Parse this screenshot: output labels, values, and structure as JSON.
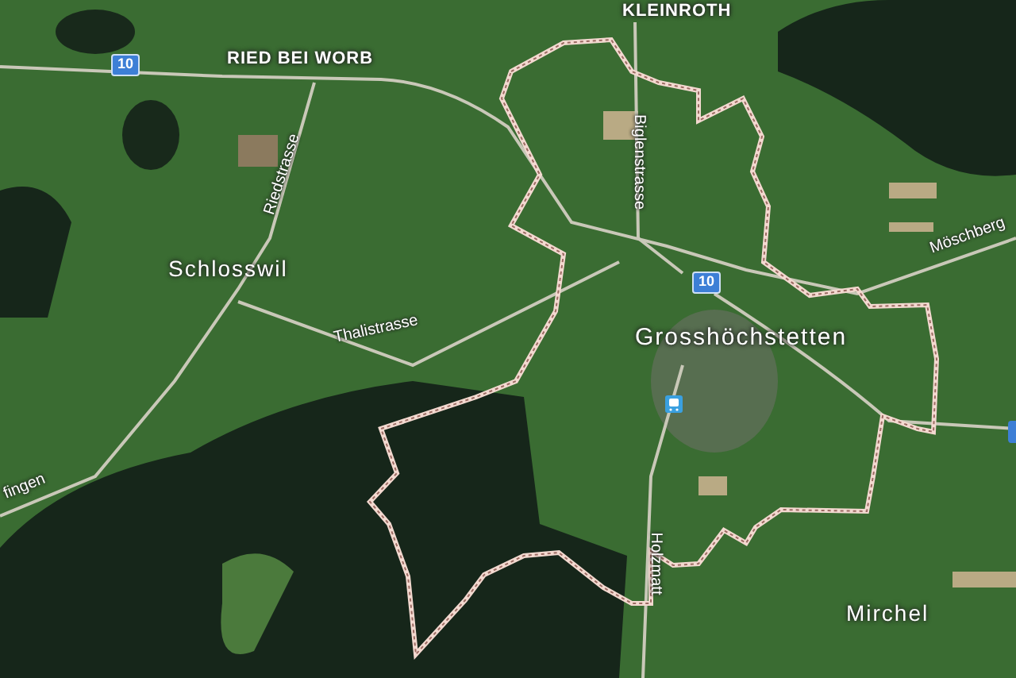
{
  "map": {
    "place_labels": [
      {
        "text": "KLEINROTH",
        "kind": "locality"
      },
      {
        "text": "RIED BEI WORB",
        "kind": "locality"
      },
      {
        "text": "Schlosswil",
        "kind": "village"
      },
      {
        "text": "Grosshöchstetten",
        "kind": "town"
      },
      {
        "text": "Mirchel",
        "kind": "village"
      }
    ],
    "street_labels": [
      {
        "text": "Biglenstrasse"
      },
      {
        "text": "Riedstrasse"
      },
      {
        "text": "Thalistrasse"
      },
      {
        "text": "Möschberg"
      },
      {
        "text": "Holzmatt"
      },
      {
        "text": "fingen"
      }
    ],
    "route_shields": [
      {
        "text": "10"
      },
      {
        "text": "10"
      }
    ]
  }
}
